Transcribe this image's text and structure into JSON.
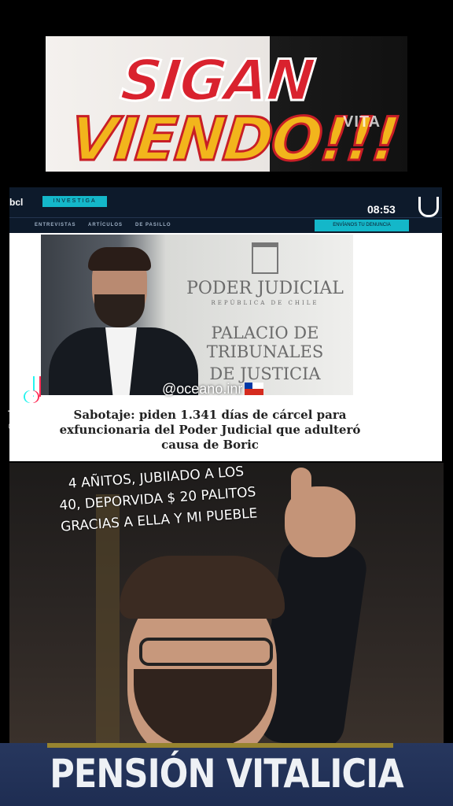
{
  "banner": {
    "line1": "SIGAN",
    "line2": "VIENDO!!!"
  },
  "watermark_logo": "VITA",
  "news": {
    "brand": "bcl",
    "live_tag": "INVESTIGA",
    "clock": "08:53",
    "nav": [
      "ENTREVISTAS",
      "ARTÍCULOS",
      "DE PASILLO"
    ],
    "nav_button": "ENVÍANOS TU DENUNCIA",
    "sign_line1": "PODER JUDICIAL",
    "sign_line2": "REPÚBLICA DE CHILE",
    "sign_line3": "PALACIO DE TRIBUNALES",
    "sign_line4": "DE JUSTICIA",
    "headline": "Sabotaje: piden 1.341 días de cárcel para exfuncionaria del Poder Judicial que adulteró causa de Boric"
  },
  "tiktok": {
    "word": "TikTok",
    "user": "@ oceano"
  },
  "handle": "@oceano.inr",
  "caption": [
    "4 AÑITOS, JUBIIADO A LOS",
    "40, DEPORVIDA $ 20 PALITOS",
    "GRACIAS A ELLA Y MI PUEBLE"
  ],
  "bottom_title": "PENSIÓN VITALICIA",
  "colors": {
    "banner_red": "#d9222e",
    "banner_yellow": "#f2b51c",
    "news_navy": "#0d1a2b",
    "accent_cyan": "#14b7c9",
    "bottom_bar": "#1e2d52"
  }
}
